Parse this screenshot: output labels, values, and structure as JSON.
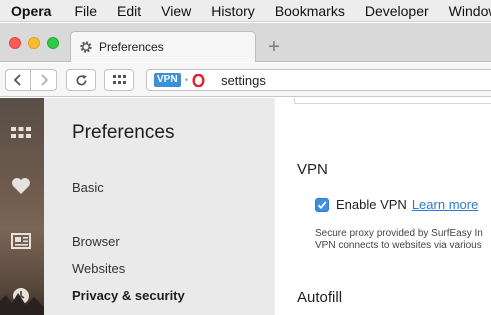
{
  "menu_bar": {
    "app_name": "Opera",
    "items": [
      "File",
      "Edit",
      "View",
      "History",
      "Bookmarks",
      "Developer",
      "Window"
    ]
  },
  "tab": {
    "title": "Preferences",
    "icon": "gear-icon"
  },
  "new_tab": {
    "label": "+"
  },
  "address_bar": {
    "vpn_badge": "VPN",
    "separator": "•",
    "url": "settings"
  },
  "sidebar": {
    "icons": [
      "speed-dial-icon",
      "heart-icon",
      "news-icon",
      "history-icon"
    ]
  },
  "settings_nav": {
    "title": "Preferences",
    "items": {
      "basic": "Basic",
      "browser": "Browser",
      "websites": "Websites",
      "privacy": "Privacy & security"
    },
    "active": "Privacy & security"
  },
  "content": {
    "vpn_section_title": "VPN",
    "vpn_checkbox_label": "Enable VPN",
    "vpn_checked": true,
    "vpn_link": "Learn more",
    "vpn_description_line1": "Secure proxy provided by SurfEasy In",
    "vpn_description_line2": "VPN connects to websites via various",
    "autofill_section_title": "Autofill"
  },
  "colors": {
    "accent": "#3f8fe0",
    "vpn_badge": "#3c8fd8",
    "opera_red": "#e3232c",
    "link": "#2a7ad2"
  }
}
